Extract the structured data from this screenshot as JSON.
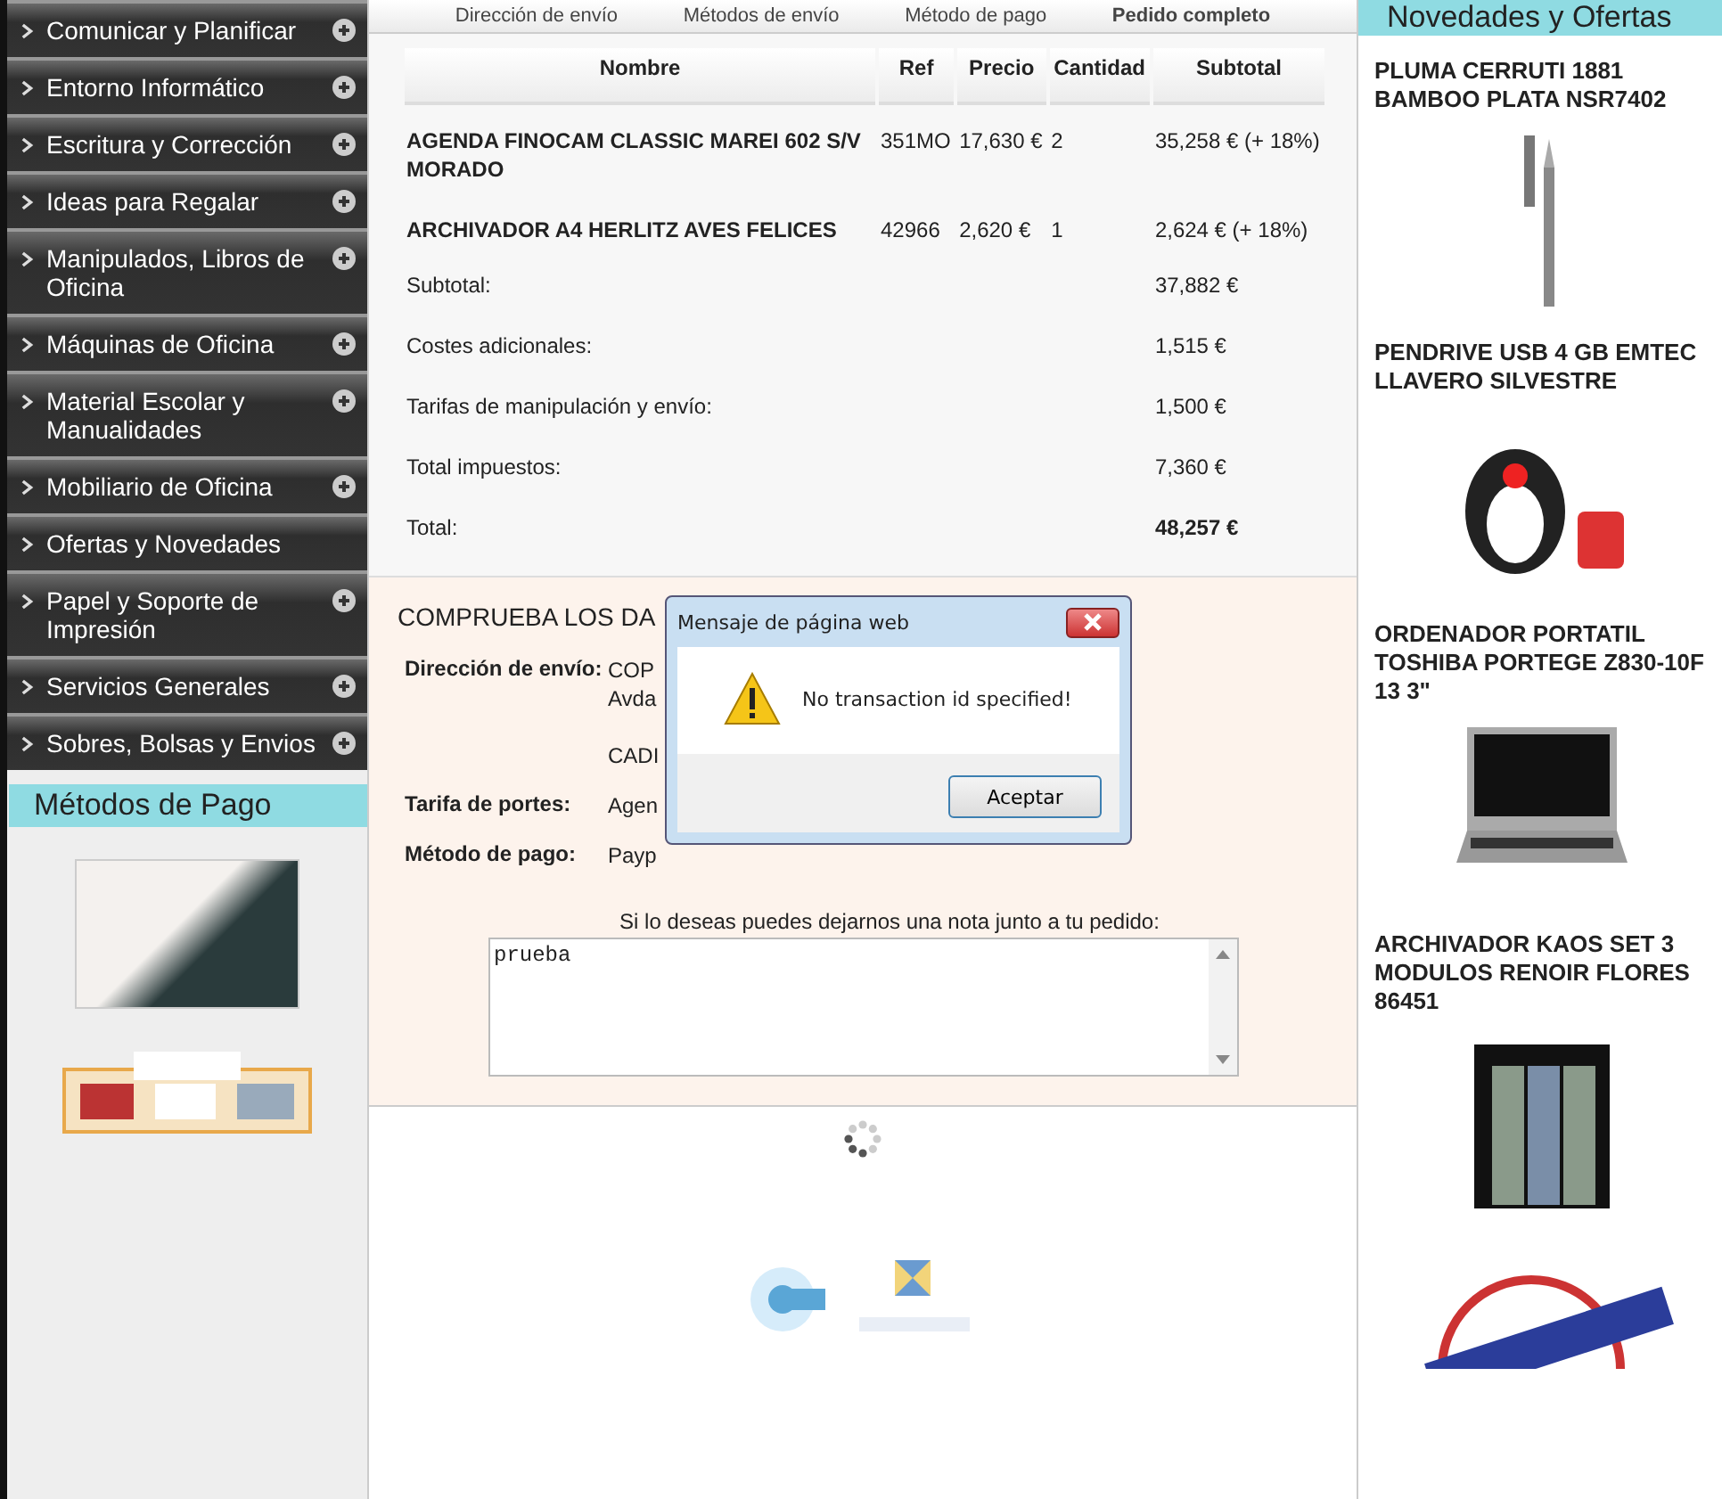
{
  "sidebar": {
    "categories": [
      {
        "label": "Comunicar y Planificar",
        "expandable": true
      },
      {
        "label": "Entorno Informático",
        "expandable": true
      },
      {
        "label": "Escritura y Corrección",
        "expandable": true
      },
      {
        "label": "Ideas para Regalar",
        "expandable": true
      },
      {
        "label": "Manipulados, Libros de Oficina",
        "expandable": true
      },
      {
        "label": "Máquinas de Oficina",
        "expandable": true
      },
      {
        "label": "Material Escolar y Manualidades",
        "expandable": true
      },
      {
        "label": "Mobiliario de Oficina",
        "expandable": true
      },
      {
        "label": "Ofertas y Novedades",
        "expandable": false
      },
      {
        "label": "Papel y Soporte de Impresión",
        "expandable": true
      },
      {
        "label": "Servicios Generales",
        "expandable": true
      },
      {
        "label": "Sobres, Bolsas y Envios",
        "expandable": true
      }
    ],
    "payment_title": "Métodos de Pago"
  },
  "checkout_steps": [
    "Dirección de envío",
    "Métodos de envío",
    "Método de pago",
    "Pedido completo"
  ],
  "order_table": {
    "columns": [
      "Nombre",
      "Ref",
      "Precio",
      "Cantidad",
      "Subtotal"
    ],
    "rows": [
      {
        "name": "AGENDA FINOCAM CLASSIC MAREI 602 S/V MORADO",
        "ref": "351MO",
        "price": "17,630 €",
        "quantity": "2",
        "subtotal": "35,258 € (+ 18%)"
      },
      {
        "name": "ARCHIVADOR A4 HERLITZ AVES FELICES",
        "ref": "42966",
        "price": "2,620 €",
        "quantity": "1",
        "subtotal": "2,624 € (+ 18%)"
      }
    ],
    "summary": [
      {
        "label": "Subtotal:",
        "value": "37,882 €",
        "bold": false
      },
      {
        "label": "Costes adicionales:",
        "value": "1,515 €",
        "bold": false
      },
      {
        "label": "Tarifas de manipulación y envío:",
        "value": "1,500 €",
        "bold": false
      },
      {
        "label": "Total impuestos:",
        "value": "7,360 €",
        "bold": false
      },
      {
        "label": "Total:",
        "value": "48,257 €",
        "bold": true
      }
    ]
  },
  "review": {
    "heading": "COMPRUEBA LOS DA",
    "details": [
      {
        "label": "Dirección de envío:",
        "lines": [
          "COP",
          "Avda",
          "CADI"
        ]
      },
      {
        "label": "Tarifa de portes:",
        "lines": [
          "Agen"
        ]
      },
      {
        "label": "Método de pago:",
        "lines": [
          "Payp"
        ]
      }
    ],
    "note_label": "Si lo deseas puedes dejarnos una nota junto a tu pedido:",
    "note_value": "prueba"
  },
  "dialog": {
    "title": "Mensaje de página web",
    "message": "No transaction id specified!",
    "button": "Aceptar"
  },
  "news": {
    "title": "Novedades y Ofertas",
    "products": [
      {
        "name": "PLUMA CERRUTI 1881 BAMBOO PLATA NSR7402",
        "kind": "pen"
      },
      {
        "name": "PENDRIVE USB 4 GB EMTEC LLAVERO SILVESTRE",
        "kind": "usb"
      },
      {
        "name": "ORDENADOR PORTATIL TOSHIBA PORTEGE Z830-10F 13 3\"",
        "kind": "laptop"
      },
      {
        "name": "ARCHIVADOR KAOS SET 3 MODULOS RENOIR FLORES 86451",
        "kind": "binder"
      }
    ]
  }
}
